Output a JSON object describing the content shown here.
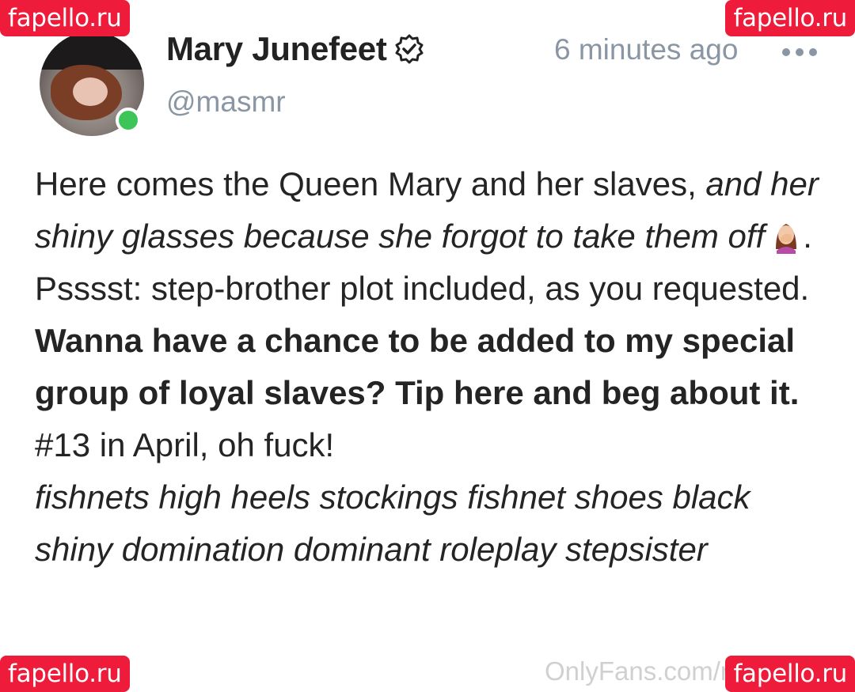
{
  "watermarks": {
    "top_left": "fapello.ru",
    "top_right": "fapello.ru",
    "bottom_left": "fapello.ru",
    "bottom_right": "fapello.ru",
    "onlyfans": "OnlyFans.com/r"
  },
  "post": {
    "author_name": "Mary Junefeet",
    "handle": "@masmr",
    "timestamp": "6 minutes ago",
    "verified_icon": "verified-badge-icon",
    "more_icon": "more-dots-icon",
    "online_color": "#3ec55a",
    "body": {
      "line1_regular": "Here comes the Queen Mary and her slaves, ",
      "line1_italic": "and her shiny glasses because she forgot to take them off",
      "line1_end": ".",
      "emoji_icon": "facepalm-emoji",
      "line2": "Psssst: step-brother plot included, as you requested.",
      "line3": "Wanna have a chance to be added to my special group of loyal slaves? Tip here and beg about it.",
      "line4": "#13 in April, oh fuck!",
      "tags": "fishnets high heels stockings fishnet shoes black shiny domination dominant roleplay stepsister"
    }
  },
  "colors": {
    "watermark_bg": "#ee1c3a",
    "muted_text": "#8a96a3",
    "body_text": "#242424"
  }
}
